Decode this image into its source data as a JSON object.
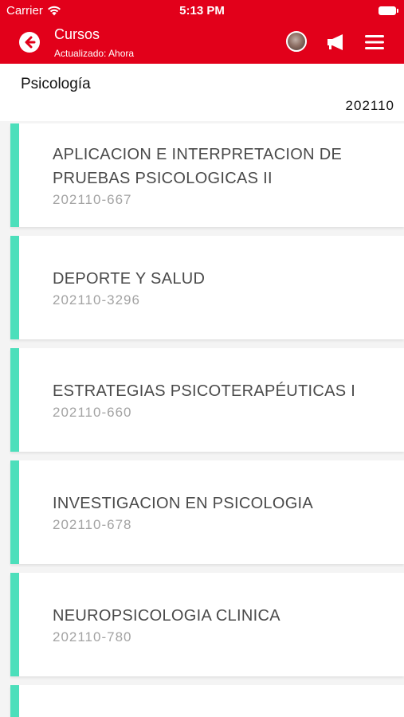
{
  "status_bar": {
    "carrier": "Carrier",
    "time": "5:13 PM"
  },
  "header": {
    "title": "Cursos",
    "subtitle": "Actualizado: Ahora"
  },
  "section": {
    "title": "Psicología",
    "code": "202110"
  },
  "courses": [
    {
      "name": "APLICACION E INTERPRETACION DE PRUEBAS PSICOLOGICAS II",
      "code": "202110-667"
    },
    {
      "name": "DEPORTE Y SALUD",
      "code": "202110-3296"
    },
    {
      "name": "ESTRATEGIAS PSICOTERAPÉUTICAS I",
      "code": "202110-660"
    },
    {
      "name": "INVESTIGACION EN PSICOLOGIA",
      "code": "202110-678"
    },
    {
      "name": "NEUROPSICOLOGIA CLINICA",
      "code": "202110-780"
    }
  ],
  "colors": {
    "brand": "#e2001a",
    "accent": "#4cdfbb"
  },
  "icons": [
    "wifi-icon",
    "battery-icon",
    "back-arrow-icon",
    "avatar",
    "megaphone-icon",
    "hamburger-menu-icon"
  ]
}
